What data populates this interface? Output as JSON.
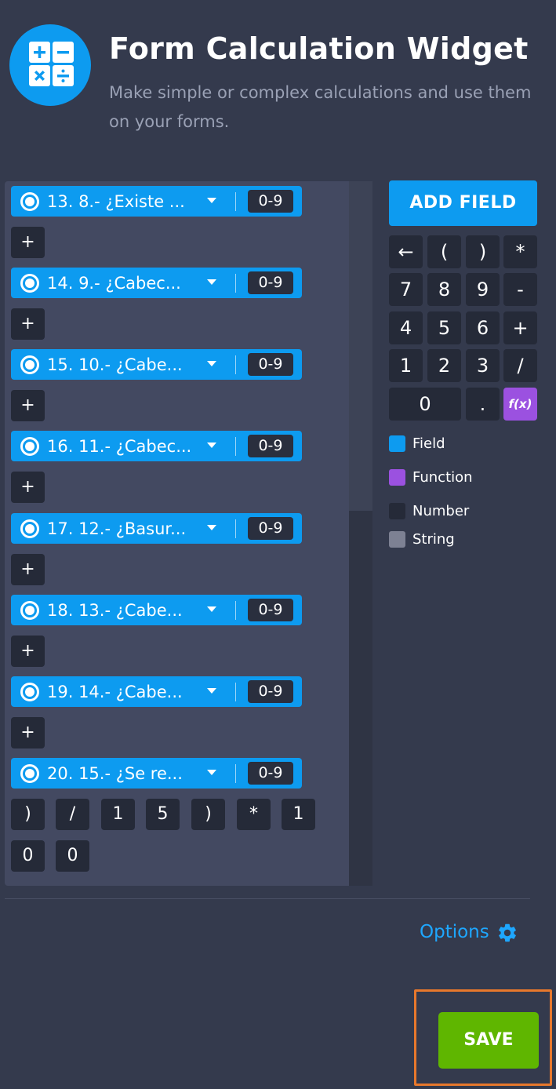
{
  "header": {
    "title": "Form Calculation Widget",
    "subtitle": "Make simple or complex calculations and use them on your forms.",
    "icon": "calculator-icon"
  },
  "editor": {
    "fields": [
      {
        "label": "13. 8.- ¿Existe ...",
        "tag": "0-9"
      },
      {
        "label": "14. 9.- ¿Cabec...",
        "tag": "0-9"
      },
      {
        "label": "15. 10.- ¿Cabe...",
        "tag": "0-9"
      },
      {
        "label": "16. 11.- ¿Cabec...",
        "tag": "0-9"
      },
      {
        "label": "17. 12.- ¿Basur...",
        "tag": "0-9"
      },
      {
        "label": "18. 13.- ¿Cabe...",
        "tag": "0-9"
      },
      {
        "label": "19. 14.- ¿Cabe...",
        "tag": "0-9"
      },
      {
        "label": "20. 15.- ¿Se re...",
        "tag": "0-9"
      }
    ],
    "plus_token": "+",
    "tail_tokens": [
      ")",
      "/",
      "1",
      "5",
      ")",
      "*",
      "1",
      "0",
      "0"
    ]
  },
  "calculator": {
    "add_field_label": "ADD FIELD",
    "keys": [
      "←",
      "(",
      ")",
      "*",
      "7",
      "8",
      "9",
      "-",
      "4",
      "5",
      "6",
      "+",
      "1",
      "2",
      "3",
      "/",
      "0",
      ".",
      "f(x)"
    ]
  },
  "legend": [
    {
      "label": "Field",
      "color": "#0d9bf0"
    },
    {
      "label": "Function",
      "color": "#9b51e0"
    },
    {
      "label": "Number",
      "color": "#252a38"
    },
    {
      "label": "String",
      "color": "#7d8193"
    }
  ],
  "footer": {
    "options_label": "Options",
    "save_label": "SAVE"
  },
  "colors": {
    "background": "#343a4d",
    "accent": "#0d9bf0",
    "save": "#5fb600",
    "highlight": "#e8782c"
  }
}
